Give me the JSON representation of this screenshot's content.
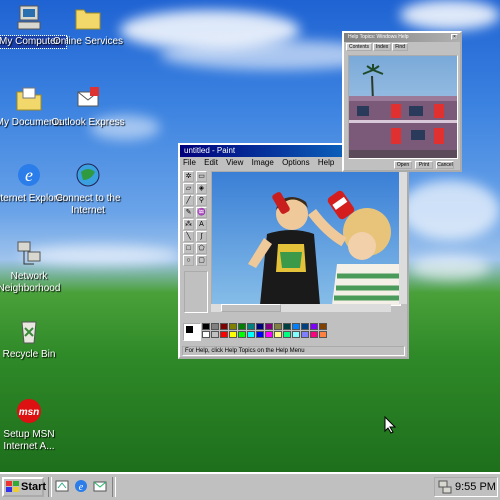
{
  "desktop_icons": [
    {
      "label": "My Computer",
      "icon": "my-computer-icon"
    },
    {
      "label": "Online Services",
      "icon": "folder-icon"
    },
    {
      "label": "My Documents",
      "icon": "my-documents-icon"
    },
    {
      "label": "Outlook Express",
      "icon": "outlook-express-icon"
    },
    {
      "label": "Internet Explorer",
      "icon": "internet-explorer-icon"
    },
    {
      "label": "Connect to the Internet",
      "icon": "connect-internet-icon"
    },
    {
      "label": "Network Neighborhood",
      "icon": "network-icon"
    },
    {
      "label": "Recycle Bin",
      "icon": "recycle-bin-icon"
    },
    {
      "label": "Setup MSN Internet A...",
      "icon": "msn-icon",
      "badge": "msn"
    }
  ],
  "paint": {
    "title": "untitled - Paint",
    "menu": [
      "File",
      "Edit",
      "View",
      "Image",
      "Options",
      "Help"
    ],
    "status": "For Help, click Help Topics on the Help Menu",
    "palette": [
      "#000000",
      "#808080",
      "#800000",
      "#808000",
      "#008000",
      "#008080",
      "#000080",
      "#800080",
      "#808040",
      "#004040",
      "#0080ff",
      "#004080",
      "#8000ff",
      "#804000",
      "#ffffff",
      "#c0c0c0",
      "#ff0000",
      "#ffff00",
      "#00ff00",
      "#00ffff",
      "#0000ff",
      "#ff00ff",
      "#ffff80",
      "#00ff80",
      "#80ffff",
      "#8080ff",
      "#ff0080",
      "#ff8040"
    ]
  },
  "help_window": {
    "title": "Help Topics: Windows Help",
    "tabs": [
      "Contents",
      "Index",
      "Find"
    ],
    "buttons": [
      "Open",
      "Print",
      "Cancel"
    ]
  },
  "taskbar": {
    "start_label": "Start",
    "quick_launch": [
      "show-desktop-icon",
      "internet-explorer-icon",
      "outlook-express-icon"
    ],
    "clock": "9:55 PM"
  }
}
